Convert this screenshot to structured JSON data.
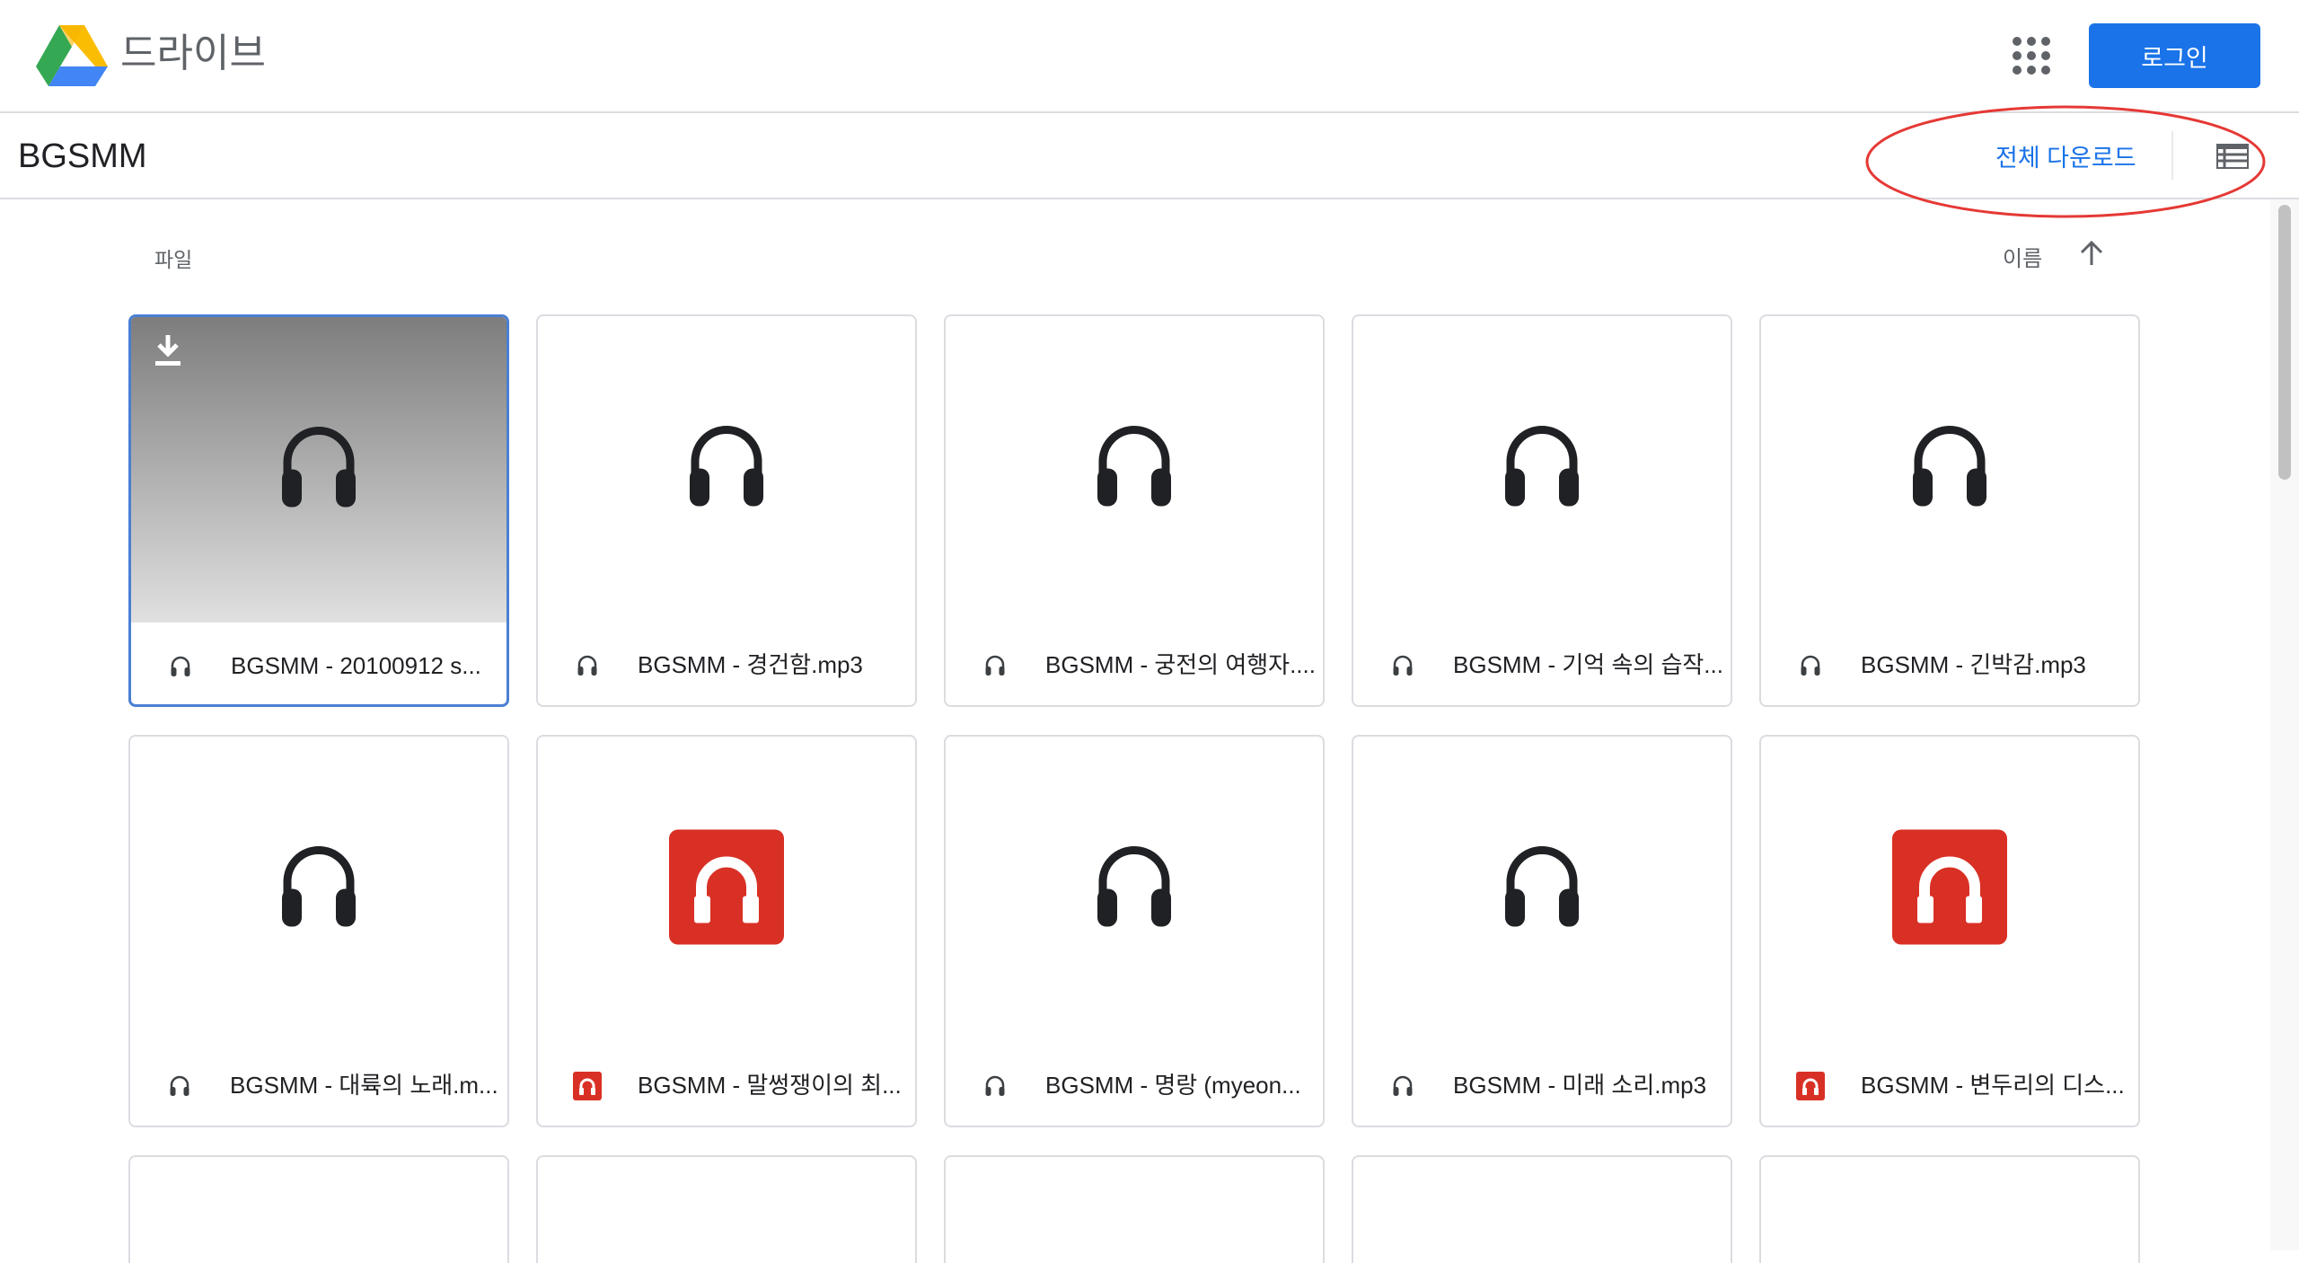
{
  "header": {
    "app_title": "드라이브",
    "login_label": "로그인"
  },
  "toolbar": {
    "folder_title": "BGSMM",
    "download_all_label": "전체 다운로드"
  },
  "content": {
    "section_label": "파일",
    "sort_label": "이름"
  },
  "files": [
    {
      "name": "BGSMM - 20100912 s...",
      "icon": "headphones-icon",
      "selected": true
    },
    {
      "name": "BGSMM - 경건함.mp3",
      "icon": "headphones-icon"
    },
    {
      "name": "BGSMM - 궁전의 여행자....",
      "icon": "headphones-icon"
    },
    {
      "name": "BGSMM - 기억 속의 습작...",
      "icon": "headphones-icon"
    },
    {
      "name": "BGSMM - 긴박감.mp3",
      "icon": "headphones-icon"
    },
    {
      "name": "BGSMM - 대륙의 노래.m...",
      "icon": "headphones-icon"
    },
    {
      "name": "BGSMM - 말썽쟁이의 최...",
      "icon": "red-audio-icon"
    },
    {
      "name": "BGSMM - 명랑 (myeon...",
      "icon": "headphones-icon"
    },
    {
      "name": "BGSMM - 미래 소리.mp3",
      "icon": "headphones-icon"
    },
    {
      "name": "BGSMM - 변두리의 디스...",
      "icon": "red-audio-icon"
    }
  ],
  "colors": {
    "accent": "#1a73e8",
    "annotation": "#e53935",
    "audio_red": "#d93025"
  }
}
